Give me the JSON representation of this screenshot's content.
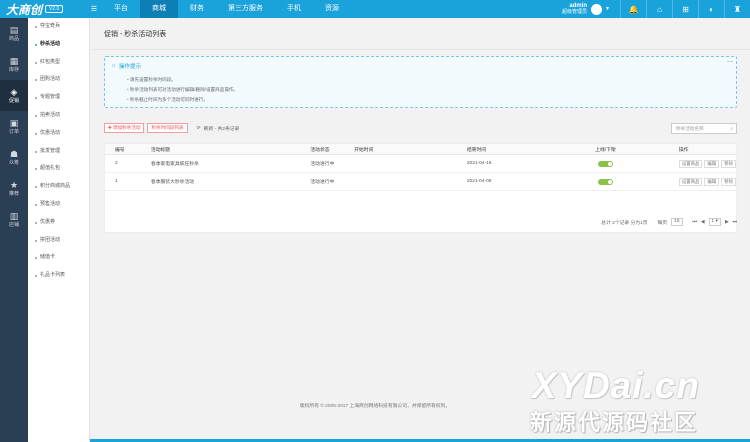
{
  "topbar": {
    "logo": "大商创",
    "version": "V2.0",
    "nav": [
      "平台",
      "商城",
      "财务",
      "第三方服务",
      "手机",
      "资源"
    ],
    "active_index": 1,
    "user_name": "admin",
    "user_role": "超级管理员",
    "accent": "#1aa2db"
  },
  "leftnav": [
    {
      "label": "商品",
      "icon": "goods-icon"
    },
    {
      "label": "库存",
      "icon": "inventory-icon"
    },
    {
      "label": "促销",
      "icon": "promotion-icon",
      "active": true
    },
    {
      "label": "订单",
      "icon": "order-icon"
    },
    {
      "label": "众筹",
      "icon": "crowdfund-icon"
    },
    {
      "label": "推荐",
      "icon": "star-icon"
    },
    {
      "label": "店铺",
      "icon": "store-icon"
    }
  ],
  "submenu": [
    "夺宝奇兵",
    "秒杀活动",
    "红包类型",
    "团购活动",
    "专题管理",
    "拍卖活动",
    "优惠活动",
    "批发管理",
    "超值礼包",
    "积分商城商品",
    "预售活动",
    "优惠券",
    "拼团活动",
    "储值卡",
    "礼品卡列表"
  ],
  "submenu_active": 1,
  "page": {
    "breadcrumb": "促销 - 秒杀活动列表",
    "tips_title": "操作提示",
    "tips": [
      "请先设置秒杀时间段。",
      "秒杀活动列表可对活动进行编辑/删除/设置商品操作。",
      "秒杀截止时间为多个活动可同时进行。"
    ],
    "add_button": "添加秒杀活动",
    "time_button": "秒杀时间段列表",
    "refresh_text": "刷新 - 共2条记录",
    "search_placeholder": "秒杀活动名称"
  },
  "table": {
    "headers": [
      "编号",
      "活动标题",
      "活动状态",
      "开始时间",
      "结束时间",
      "上线/下架",
      "操作"
    ],
    "rows": [
      {
        "id": "2",
        "title": "春季家电家具疯狂秒杀",
        "status": "活动进行中",
        "start": "",
        "end": "2021-04-16",
        "online": true
      },
      {
        "id": "1",
        "title": "春季服装大秒杀活动",
        "status": "活动进行中",
        "start": "",
        "end": "2021-04-08",
        "online": true
      }
    ],
    "actions": [
      "设置商品",
      "编辑",
      "移除"
    ]
  },
  "pager": {
    "summary": "总计 2个记录 分为1页",
    "per_page_label": "每页",
    "per_page": "15",
    "current": "1"
  },
  "footer": "版权所有 © 2005-2017 上海商创网络科技有限公司，并保留所有权利。",
  "watermark": {
    "line1": "XYDai.cn",
    "line2": "新源代源码社区"
  }
}
